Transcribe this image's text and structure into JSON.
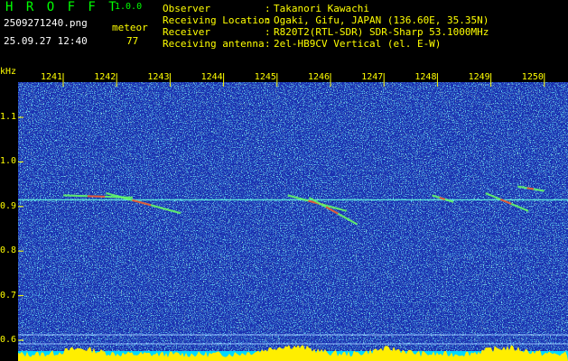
{
  "header": {
    "app_title": "H R O F F T",
    "app_version": "1.0.0",
    "file_name": "2509271240.png",
    "date_time": "25.09.27 12:40",
    "meteor_label": "meteor",
    "meteor_count": "77",
    "info": [
      {
        "label": "Observer",
        "value": "Takanori Kawachi"
      },
      {
        "label": "Receiving Location",
        "value": "Ogaki, Gifu, JAPAN (136.60E, 35.35N)"
      },
      {
        "label": "Receiver",
        "value": "R820T2(RTL-SDR) SDR-Sharp 53.1000MHz"
      },
      {
        "label": "Receiving antenna",
        "value": "2el-HB9CV Vertical (el. E-W)"
      }
    ]
  },
  "colors": {
    "background": "#000000",
    "plot_background": "#1a2fb0",
    "label": "#ffff00",
    "accent": "#00ff00",
    "text": "#ffffff"
  },
  "spectrogram": {
    "y_unit": "kHz",
    "y_ticks": [
      "1.1",
      "1.0",
      "0.9",
      "0.8",
      "0.7",
      "0.6"
    ],
    "x_ticks": [
      "1241",
      "1242",
      "1243",
      "1244",
      "1245",
      "1246",
      "1247",
      "1248",
      "1249",
      "1250"
    ],
    "carrier_khz": 0.915,
    "meteor_traces": [
      {
        "start_min": 1241.0,
        "end_min": 1242.3,
        "start_khz": 0.925,
        "end_khz": 0.92
      },
      {
        "start_min": 1241.8,
        "end_min": 1243.2,
        "start_khz": 0.93,
        "end_khz": 0.885
      },
      {
        "start_min": 1245.2,
        "end_min": 1246.3,
        "start_khz": 0.925,
        "end_khz": 0.89
      },
      {
        "start_min": 1245.6,
        "end_min": 1246.5,
        "start_khz": 0.92,
        "end_khz": 0.86
      },
      {
        "start_min": 1247.9,
        "end_min": 1248.3,
        "start_khz": 0.925,
        "end_khz": 0.91
      },
      {
        "start_min": 1248.9,
        "end_min": 1249.7,
        "start_khz": 0.93,
        "end_khz": 0.89
      },
      {
        "start_min": 1249.5,
        "end_min": 1250.0,
        "start_khz": 0.945,
        "end_khz": 0.935
      }
    ]
  }
}
